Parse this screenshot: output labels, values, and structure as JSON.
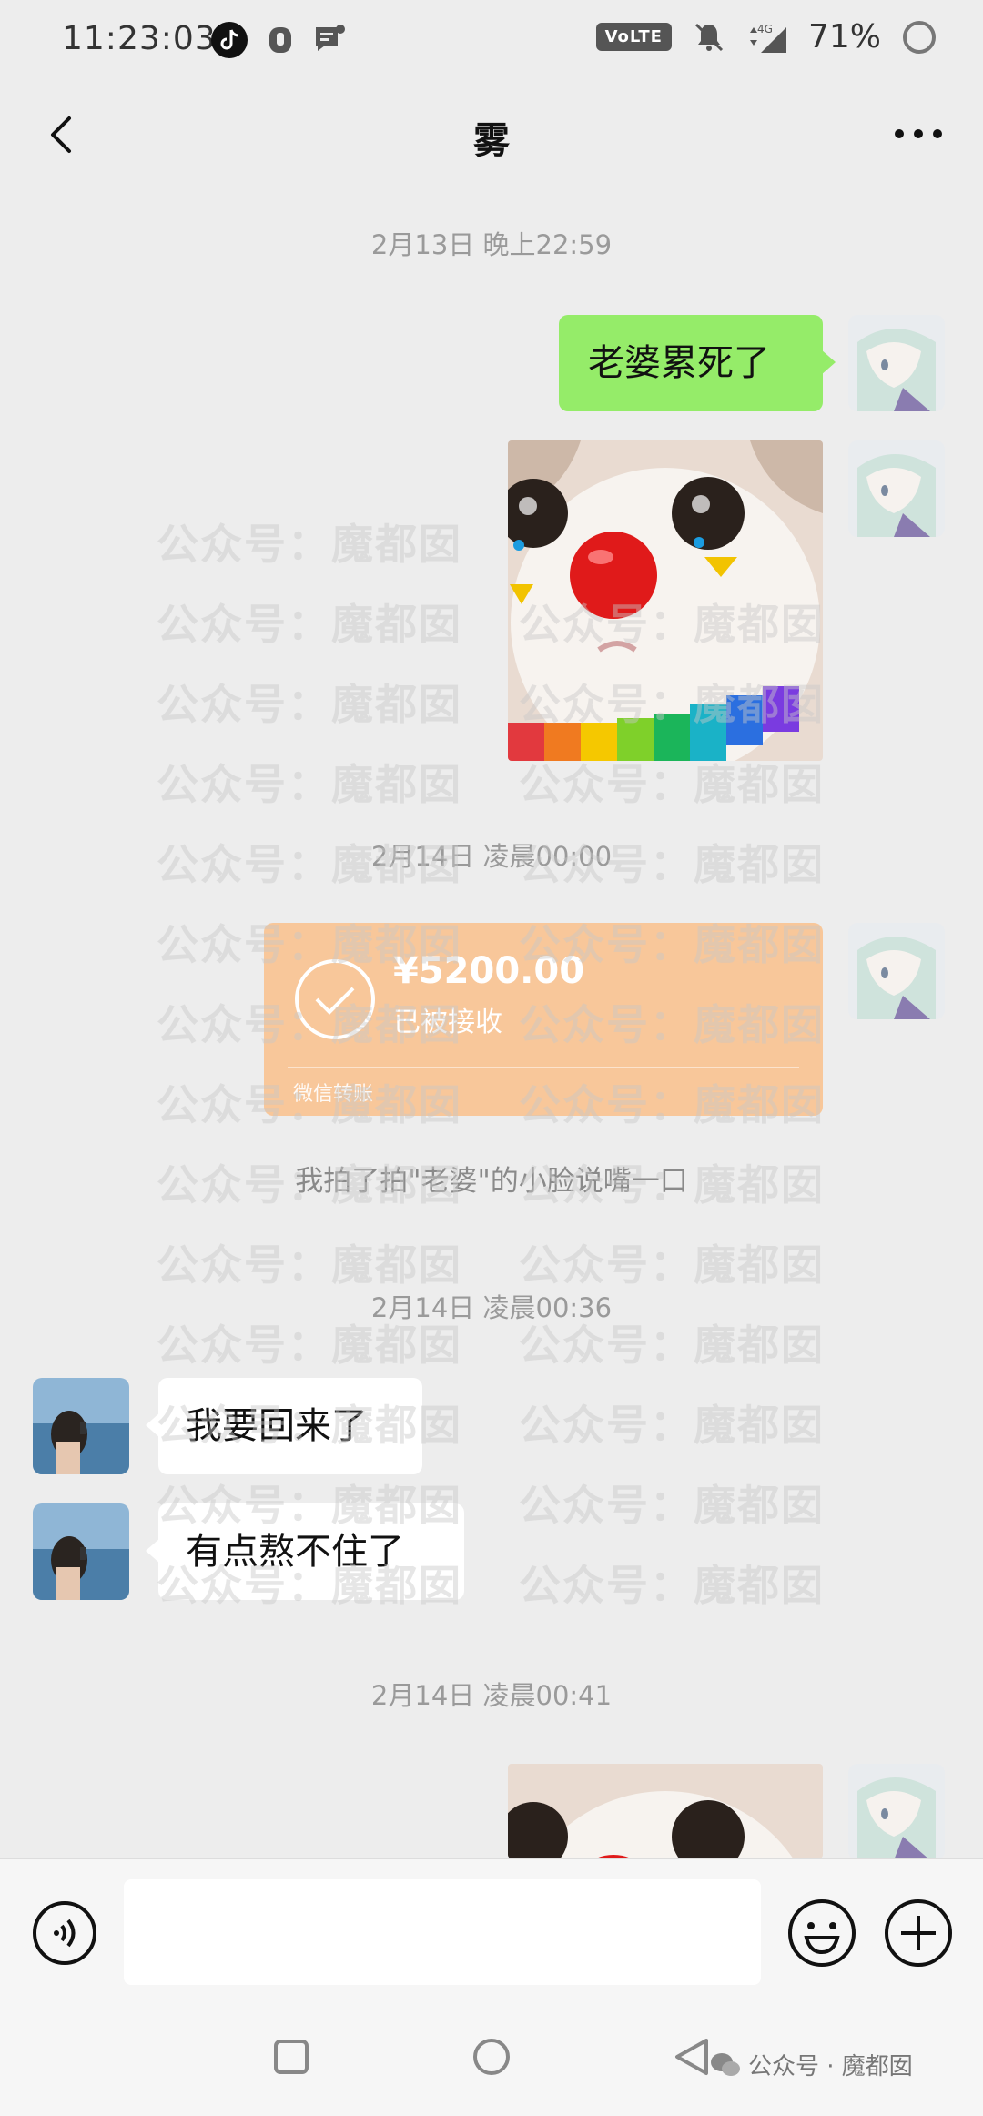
{
  "status_bar": {
    "time": "11:23:03",
    "volte": "VoLTE",
    "network": "4G",
    "battery": "71%"
  },
  "header": {
    "title": "雾",
    "icons": [
      "back-arrow-icon",
      "more-dots-icon"
    ]
  },
  "messages": {
    "ts1": "2月13日 晚上22:59",
    "msg1": "老婆累死了",
    "ts2": "2月14日 凌晨00:00",
    "transfer_amount": "¥5200.00",
    "transfer_status": "已被接收",
    "transfer_footer": "微信转账",
    "system_msg": "我拍了拍\"老婆\"的小脸说嘴一口",
    "ts3": "2月14日 凌晨00:36",
    "msg2": "我要回来了",
    "msg3": "有点熬不住了",
    "ts4": "2月14日 凌晨00:41"
  },
  "input_bar": {
    "placeholder": "",
    "icons": [
      "voice-icon",
      "emoji-icon",
      "plus-icon"
    ]
  },
  "nav_bar": {
    "icons": [
      "recents-square-icon",
      "home-circle-icon",
      "back-triangle-icon"
    ]
  },
  "watermark": {
    "text": "公众号：魔都囡",
    "footer": "公众号 · 魔都囡"
  },
  "colors": {
    "background": "#ededed",
    "my_bubble": "#95ec69",
    "their_bubble": "#ffffff",
    "transfer_card": "#f8c79a",
    "timestamp_text": "#9a9a9a"
  }
}
